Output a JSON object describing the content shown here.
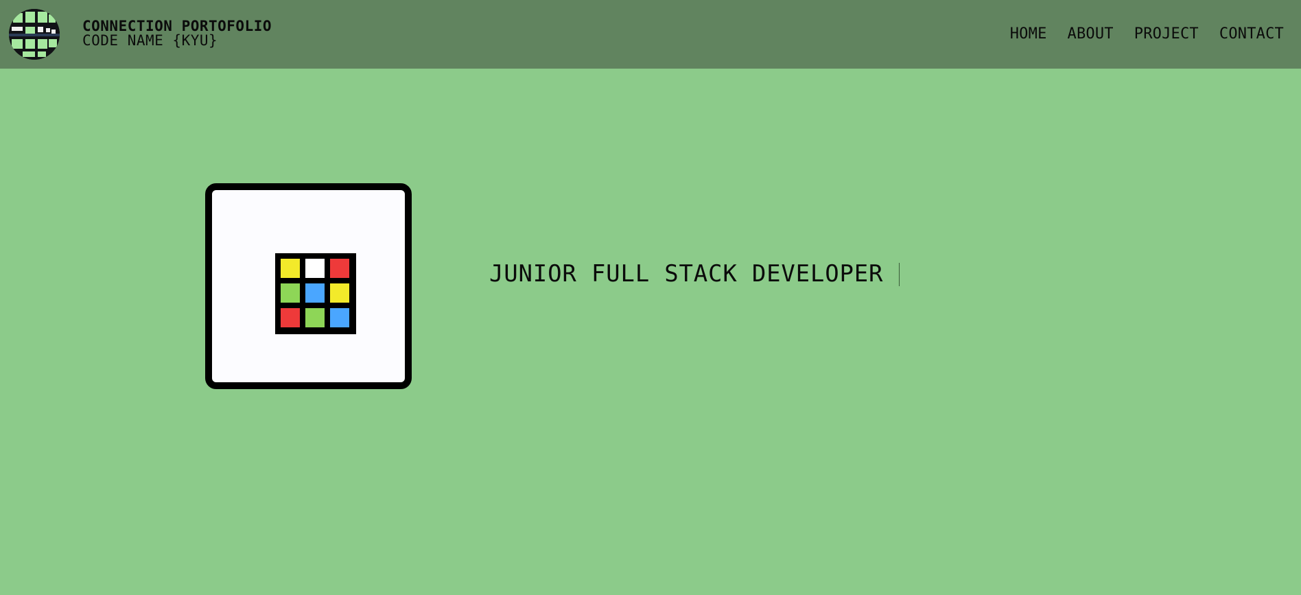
{
  "header": {
    "title": "CONNECTION PORTOFOLIO",
    "subtitle": "CODE NAME {KYU}",
    "logo_icon": "pixel-grid-logo-icon"
  },
  "nav": {
    "items": [
      {
        "label": "HOME"
      },
      {
        "label": "ABOUT"
      },
      {
        "label": "PROJECT"
      },
      {
        "label": "CONTACT"
      }
    ]
  },
  "hero": {
    "role": "JUNIOR FULL STACK DEVELOPER",
    "card_icon": "rubiks-cube-icon",
    "cube_colors": [
      "#f3ea2a",
      "#ffffff",
      "#ee3a3a",
      "#8ed657",
      "#4aa6ff",
      "#f3ea2a",
      "#ee3a3a",
      "#8ed657",
      "#4aa6ff"
    ]
  },
  "colors": {
    "background": "#8ccb8a",
    "navbar": "#61845f",
    "text": "#0b0b0b"
  }
}
